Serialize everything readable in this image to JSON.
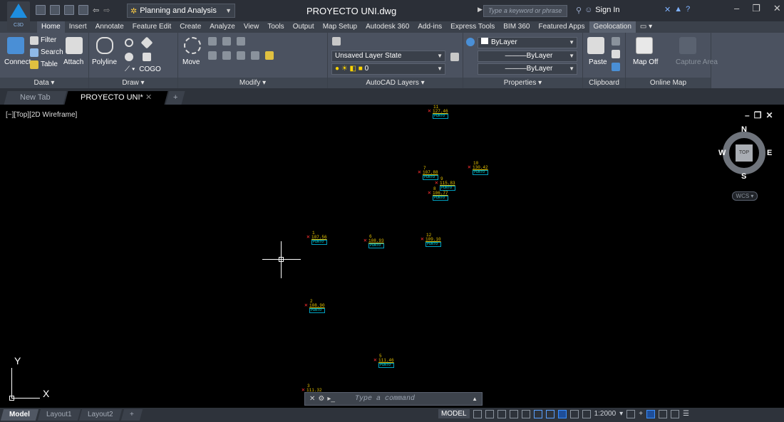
{
  "app": {
    "logo_text": "C3D",
    "document_title": "PROYECTO UNI.dwg"
  },
  "workspace": {
    "label": "Planning and Analysis"
  },
  "search": {
    "placeholder": "Type a keyword or phrase"
  },
  "account": {
    "signin_label": "Sign In"
  },
  "ribbon_tabs": [
    "Home",
    "Insert",
    "Annotate",
    "Feature Edit",
    "Create",
    "Analyze",
    "View",
    "Tools",
    "Output",
    "Map Setup",
    "Autodesk 360",
    "Add-ins",
    "Express Tools",
    "BIM 360",
    "Featured Apps",
    "Geolocation"
  ],
  "ribbon": {
    "data_panel": {
      "title": "Data",
      "connect": "Connect",
      "filter": "Filter",
      "search": "Search",
      "table": "Table",
      "attach": "Attach"
    },
    "draw_panel": {
      "title": "Draw",
      "polyline": "Polyline",
      "cogo": "COGO"
    },
    "modify_panel": {
      "title": "Modify",
      "move": "Move"
    },
    "layers_panel": {
      "title": "AutoCAD Layers",
      "layer_state": "Unsaved Layer State",
      "current_layer": "0"
    },
    "properties_panel": {
      "title": "Properties",
      "color": "ByLayer",
      "linetype": "ByLayer",
      "lineweight": "ByLayer"
    },
    "clipboard_panel": {
      "title": "Clipboard",
      "paste": "Paste"
    },
    "online_map_panel": {
      "title": "Online Map",
      "map_off": "Map Off",
      "capture_area": "Capture Area"
    }
  },
  "file_tabs": [
    "New Tab",
    "PROYECTO UNI*"
  ],
  "viewport": {
    "label": "[−][Top][2D Wireframe]"
  },
  "points": [
    {
      "id": "11",
      "elev": "127.46",
      "desc": "PUNTO"
    },
    {
      "id": "10",
      "elev": "130.42",
      "desc": "PUNTO"
    },
    {
      "id": "7",
      "elev": "107.88",
      "desc": "PUNTO"
    },
    {
      "id": "9",
      "elev": "115.83",
      "desc": "PUNTO"
    },
    {
      "id": "8",
      "elev": "106.77",
      "desc": "PUNTO"
    },
    {
      "id": "1",
      "elev": "107.56",
      "desc": "PUNTO"
    },
    {
      "id": "6",
      "elev": "108.93",
      "desc": "PUNTO"
    },
    {
      "id": "12",
      "elev": "109.10",
      "desc": "PUNTO"
    },
    {
      "id": "2",
      "elev": "108.90",
      "desc": "PUNTO"
    },
    {
      "id": "5",
      "elev": "111.46",
      "desc": "PUNTO"
    },
    {
      "id": "3",
      "elev": "111.32",
      "desc": ""
    }
  ],
  "viewcube": {
    "n": "N",
    "s": "S",
    "e": "E",
    "w": "W",
    "top": "TOP",
    "wcs": "WCS"
  },
  "ucs": {
    "x": "X",
    "y": "Y"
  },
  "command": {
    "placeholder": "Type a command"
  },
  "layout_tabs": [
    "Model",
    "Layout1",
    "Layout2"
  ],
  "status": {
    "model": "MODEL",
    "scale": "1:2000"
  }
}
